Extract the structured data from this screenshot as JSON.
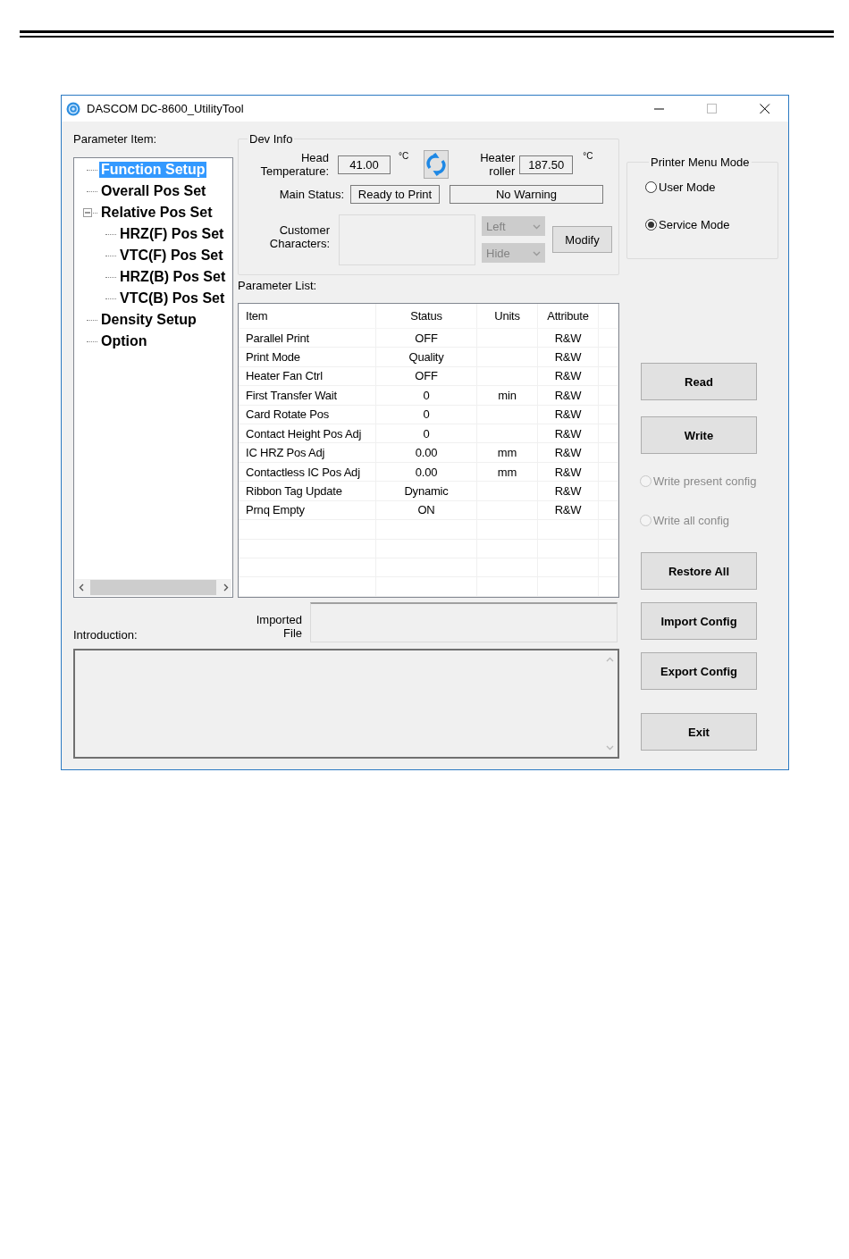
{
  "window": {
    "title": "DASCOM DC-8600_UtilityTool"
  },
  "parameter_tree": {
    "label": "Parameter Item:",
    "items": [
      {
        "label": "Function Setup",
        "selected": true
      },
      {
        "label": "Overall Pos Set",
        "selected": false
      },
      {
        "label": "Relative Pos Set",
        "selected": false,
        "expanded": true,
        "children": [
          {
            "label": "HRZ(F) Pos Set",
            "selected": false
          },
          {
            "label": "VTC(F) Pos Set",
            "selected": false
          },
          {
            "label": "HRZ(B) Pos Set",
            "selected": false
          },
          {
            "label": "VTC(B) Pos Set",
            "selected": false
          }
        ]
      },
      {
        "label": "Density Setup",
        "selected": false
      },
      {
        "label": "Option",
        "selected": false
      }
    ]
  },
  "dev_info": {
    "legend": "Dev Info",
    "head_temperature": {
      "label": "Head Temperature:",
      "value": "41.00",
      "unit": "°C"
    },
    "heater_roller": {
      "label": "Heater roller",
      "value": "187.50",
      "unit": "°C"
    },
    "main_status": {
      "label": "Main Status:",
      "value": "Ready to Print",
      "warning": "No Warning"
    },
    "customer_characters": {
      "label": "Customer Characters:",
      "align": {
        "value": "Left",
        "disabled": true
      },
      "visibility": {
        "value": "Hide",
        "disabled": true
      },
      "button": "Modify"
    }
  },
  "parameter_list": {
    "label": "Parameter List:",
    "columns": [
      "Item",
      "Status",
      "Units",
      "Attribute"
    ],
    "rows": [
      {
        "item": "Parallel Print",
        "status": "OFF",
        "attribute": "R&W"
      },
      {
        "item": "Print Mode",
        "status": "Quality",
        "attribute": "R&W"
      },
      {
        "item": "Heater Fan Ctrl",
        "status": "OFF",
        "attribute": "R&W"
      },
      {
        "item": "First Transfer Wait",
        "status": "0",
        "units": "min",
        "attribute": "R&W"
      },
      {
        "item": "Card Rotate Pos",
        "status": "0",
        "attribute": "R&W"
      },
      {
        "item": "Contact Height Pos Adj",
        "status": "0",
        "attribute": "R&W"
      },
      {
        "item": "IC HRZ Pos Adj",
        "status": "0.00",
        "units": "mm",
        "attribute": "R&W"
      },
      {
        "item": "Contactless IC Pos Adj",
        "status": "0.00",
        "units": "mm",
        "attribute": "R&W"
      },
      {
        "item": "Ribbon Tag Update",
        "status": "Dynamic",
        "attribute": "R&W"
      },
      {
        "item": "Prnq Empty",
        "status": "ON",
        "attribute": "R&W"
      }
    ]
  },
  "printer_menu_mode": {
    "legend": "Printer Menu Mode",
    "options": [
      {
        "label": "User Mode",
        "selected": false
      },
      {
        "label": "Service Mode",
        "selected": true
      }
    ]
  },
  "right_controls": [
    {
      "kind": "button",
      "label": "Read"
    },
    {
      "kind": "button",
      "label": "Write"
    },
    {
      "kind": "radio",
      "label": "Write present config",
      "selected": false,
      "disabled": true
    },
    {
      "kind": "radio",
      "label": "Write all config",
      "selected": false,
      "disabled": true
    },
    {
      "kind": "button",
      "label": "Restore All"
    },
    {
      "kind": "button",
      "label": "Import Config"
    },
    {
      "kind": "button",
      "label": "Export Config"
    },
    {
      "kind": "button",
      "label": "Exit"
    }
  ],
  "imported_file": {
    "label": "Imported File"
  },
  "introduction": {
    "label": "Introduction:"
  }
}
